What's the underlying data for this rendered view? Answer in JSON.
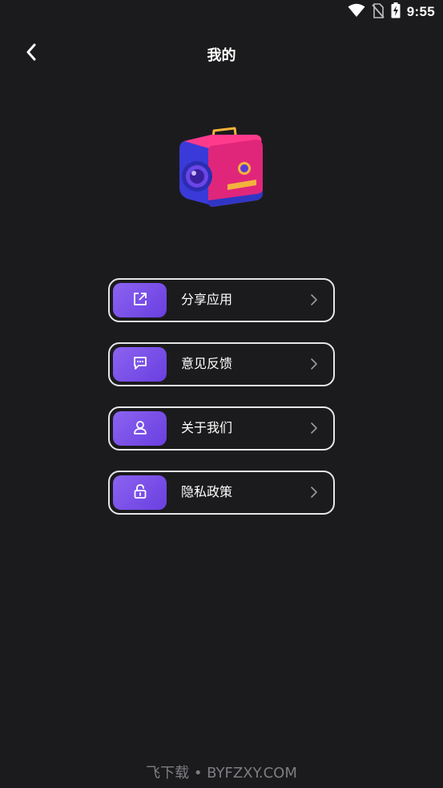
{
  "status_bar": {
    "time": "9:55",
    "icons": [
      "wifi-icon",
      "no-sim-icon",
      "battery-charging-icon"
    ]
  },
  "header": {
    "back_icon": "chevron-left-icon",
    "title": "我的"
  },
  "logo": {
    "icon": "camera-3d-icon"
  },
  "menu": {
    "items": [
      {
        "label": "分享应用",
        "icon": "share-icon"
      },
      {
        "label": "意见反馈",
        "icon": "feedback-icon"
      },
      {
        "label": "关于我们",
        "icon": "user-icon"
      },
      {
        "label": "隐私政策",
        "icon": "lock-icon"
      }
    ],
    "chevron_icon": "chevron-right-icon"
  },
  "colors": {
    "background": "#1b1b1d",
    "accent_start": "#8b63f0",
    "accent_end": "#6a3fe0",
    "item_border": "#e6e6ea"
  },
  "watermark": "飞下载 • BYFZXY.COM"
}
